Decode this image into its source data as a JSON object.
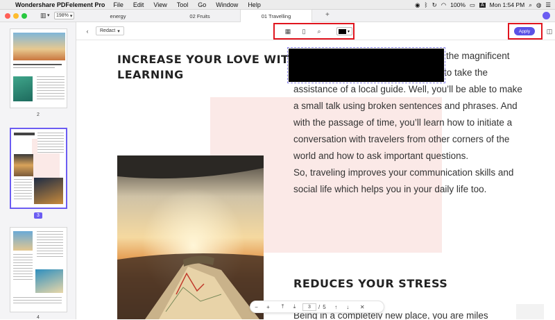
{
  "menubar": {
    "app_name": "Wondershare PDFelement Pro",
    "items": [
      "File",
      "Edit",
      "View",
      "Tool",
      "Go",
      "Window",
      "Help"
    ],
    "battery": "100%",
    "datetime": "Mon 1:54 PM"
  },
  "toolbar_top": {
    "zoom": "198%"
  },
  "tabs": [
    {
      "label": "energy"
    },
    {
      "label": "02 Fruits"
    },
    {
      "label": "01 Travelling"
    }
  ],
  "tab_add": "+",
  "sidebar": {
    "pages": [
      {
        "number": "2"
      },
      {
        "number": "3",
        "selected": true
      },
      {
        "number": "4"
      }
    ]
  },
  "toolbar": {
    "redact_label": "Redact",
    "apply_label": "Apply",
    "color_swatch": "#000000"
  },
  "document": {
    "heading1_line1": "INCREASE YOUR LOVE WITH",
    "heading1_line2": "LEARNING",
    "para_lines": [
      "the magnificent",
      "to take the",
      "assistance of a local guide. Well, you’ll be able to make",
      "a small talk using broken sentences and phrases. And",
      "with the passage of time, you’ll learn how to initiate a",
      "conversation with travelers from other corners of the",
      "world and how to ask important questions.",
      "So, traveling improves your communication skills and",
      "social life which helps you in your daily life too."
    ],
    "heading2": "REDUCES YOUR STRESS",
    "bottom_line": "Being in a completely new place, you are miles"
  },
  "pagenav": {
    "current": "3",
    "separator": "/",
    "total": "5"
  },
  "colors": {
    "accent": "#6b5cf2",
    "highlight": "#e0141e",
    "pink_block": "#fbe9e7"
  }
}
